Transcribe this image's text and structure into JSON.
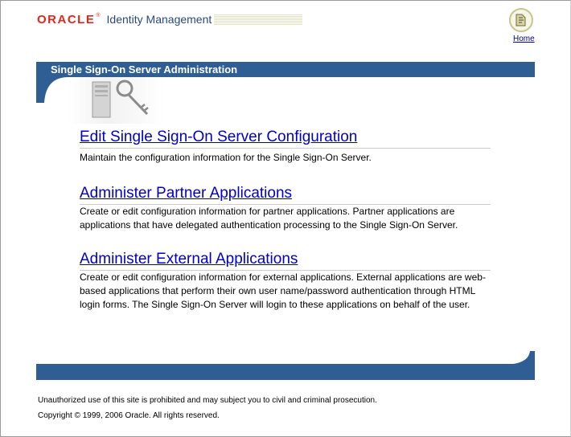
{
  "header": {
    "brand_oracle": "ORACLE",
    "brand_reg": "®",
    "brand_product": "Identity Management",
    "home_label": "Home"
  },
  "banner": {
    "title": "Single Sign-On Server Administration"
  },
  "sections": [
    {
      "link": "Edit Single Sign-On Server Configuration",
      "description": "Maintain the configuration information for the Single Sign-On Server."
    },
    {
      "link": "Administer Partner Applications",
      "description": "Create or edit configuration information for partner applications. Partner applications are applications that have delegated authentication processing to the Single Sign-On Server."
    },
    {
      "link": "Administer External Applications",
      "description": "Create or edit configuration information for external applications. External applications are web-based applications that perform their own user name/password authentication through HTML login forms. The Single Sign-On Server will login to these applications on behalf of the user."
    }
  ],
  "footer": {
    "warning": "Unauthorized use of this site is prohibited and may subject you to civil and criminal prosecution.",
    "copyright": "Copyright © 1999, 2006 Oracle. All rights reserved."
  },
  "colors": {
    "banner_blue": "#2f5e95",
    "oracle_red": "#e4261b",
    "link_blue": "#0000cc"
  },
  "icons": {
    "home": "home-globe-icon",
    "hero": "server-key-icon"
  }
}
